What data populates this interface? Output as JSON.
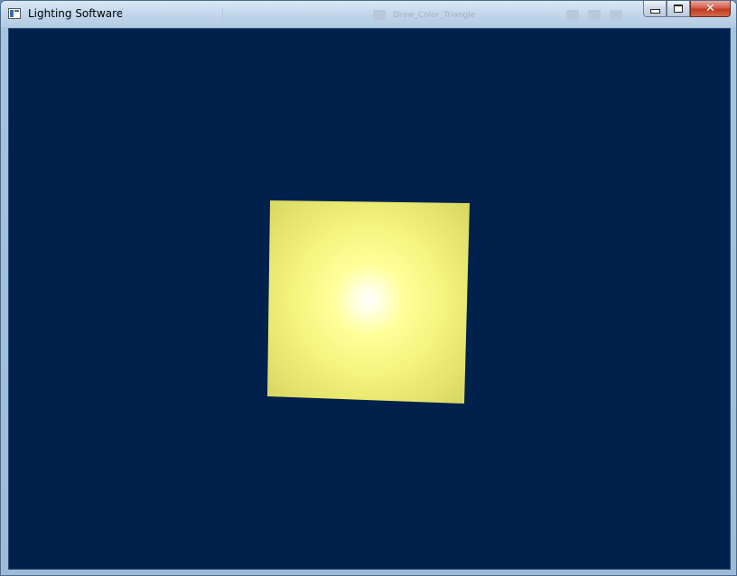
{
  "window": {
    "title": "Lighting Software",
    "background_title_text": "Draw_Color_Triangle"
  },
  "caption_buttons": {
    "minimize_icon": "minimize-icon",
    "maximize_icon": "maximize-icon",
    "close_icon": "close-icon",
    "close_glyph": "✕"
  },
  "scene": {
    "background_color": "#00214b",
    "quad_base_color": "#c9c95a",
    "highlight_color": "#ffffff",
    "glow_color": "#ffff88"
  }
}
